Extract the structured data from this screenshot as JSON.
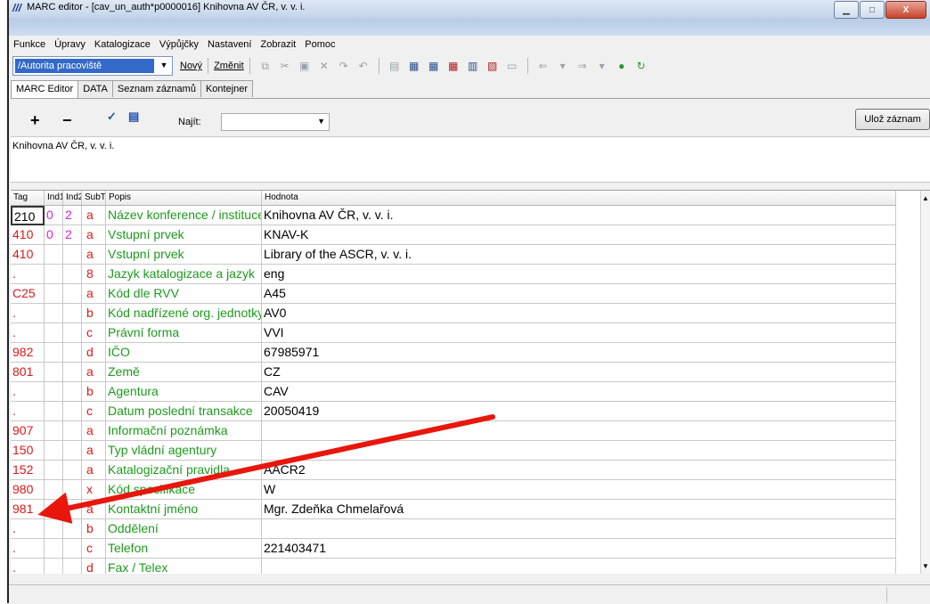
{
  "window": {
    "title": "MARC editor - [cav_un_auth*p0000016] Knihovna AV ČR, v. v. i.",
    "min_glyph": "▁",
    "max_glyph": "□",
    "close_glyph": "X"
  },
  "menu": [
    "Funkce",
    "Úpravy",
    "Katalogizace",
    "Výpůjčky",
    "Nastavení",
    "Zobrazit",
    "Pomoc"
  ],
  "toolbar": {
    "combo_value": "/Autorita pracoviště",
    "new_label": "Nový",
    "change_label": "Změnit"
  },
  "tabs": [
    "MARC Editor",
    "DATA",
    "Seznam záznamů",
    "Kontejner"
  ],
  "editor": {
    "find_label": "Najít:",
    "save_label": "Ulož záznam",
    "preview_text": "Knihovna AV ČR, v. v. i."
  },
  "grid": {
    "headers": [
      "Tag",
      "Ind1",
      "Ind2",
      "SubT",
      "Popis",
      "Hodnota"
    ],
    "rows": [
      {
        "tag": "210",
        "ind1": "0",
        "ind2": "2",
        "sub": "a",
        "popis": "Název konference / instituce",
        "val": "Knihovna AV ČR, v. v. i."
      },
      {
        "tag": "410",
        "ind1": "0",
        "ind2": "2",
        "sub": "a",
        "popis": "Vstupní prvek",
        "val": "KNAV-K"
      },
      {
        "tag": "410",
        "ind1": "",
        "ind2": "",
        "sub": "a",
        "popis": "Vstupní prvek",
        "val": "Library of the ASCR, v. v. i."
      },
      {
        "tag": ".",
        "ind1": "",
        "ind2": "",
        "sub": "8",
        "popis": "Jazyk katalogizace a jazyk",
        "val": "eng"
      },
      {
        "tag": "C25",
        "ind1": "",
        "ind2": "",
        "sub": "a",
        "popis": "Kód dle RVV",
        "val": "A45"
      },
      {
        "tag": ".",
        "ind1": "",
        "ind2": "",
        "sub": "b",
        "popis": "Kód nadřízené org. jednotky",
        "val": "AV0"
      },
      {
        "tag": ".",
        "ind1": "",
        "ind2": "",
        "sub": "c",
        "popis": "Právní forma",
        "val": "VVI"
      },
      {
        "tag": "982",
        "ind1": "",
        "ind2": "",
        "sub": "d",
        "popis": "IČO",
        "val": "67985971"
      },
      {
        "tag": "801",
        "ind1": "",
        "ind2": "",
        "sub": "a",
        "popis": "Země",
        "val": "CZ"
      },
      {
        "tag": ".",
        "ind1": "",
        "ind2": "",
        "sub": "b",
        "popis": "Agentura",
        "val": "CAV"
      },
      {
        "tag": ".",
        "ind1": "",
        "ind2": "",
        "sub": "c",
        "popis": "Datum poslední transakce",
        "val": "20050419"
      },
      {
        "tag": "907",
        "ind1": "",
        "ind2": "",
        "sub": "a",
        "popis": "Informační poznámka",
        "val": ""
      },
      {
        "tag": "150",
        "ind1": "",
        "ind2": "",
        "sub": "a",
        "popis": "Typ vládní agentury",
        "val": ""
      },
      {
        "tag": "152",
        "ind1": "",
        "ind2": "",
        "sub": "a",
        "popis": "Katalogizační pravidla",
        "val": "AACR2"
      },
      {
        "tag": "980",
        "ind1": "",
        "ind2": "",
        "sub": "x",
        "popis": "Kód specifikace",
        "val": "W"
      },
      {
        "tag": "981",
        "ind1": "",
        "ind2": "",
        "sub": "a",
        "popis": "Kontaktní jméno",
        "val": "Mgr. Zdeňka Chmelařová"
      },
      {
        "tag": ".",
        "ind1": "",
        "ind2": "",
        "sub": "b",
        "popis": "Oddělení",
        "val": ""
      },
      {
        "tag": ".",
        "ind1": "",
        "ind2": "",
        "sub": "c",
        "popis": "Telefon",
        "val": "221403471"
      },
      {
        "tag": ".",
        "ind1": "",
        "ind2": "",
        "sub": "d",
        "popis": "Fax / Telex",
        "val": ""
      }
    ]
  },
  "annotation": {
    "arrow_color": "#e8160c"
  }
}
